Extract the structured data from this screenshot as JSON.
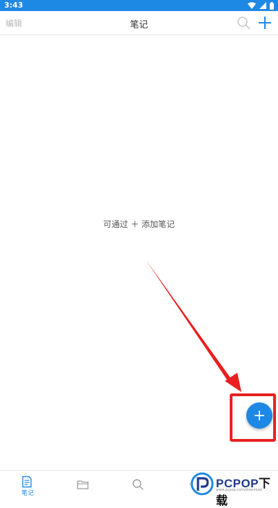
{
  "status_bar": {
    "time": "3:43",
    "icons": [
      "wifi-icon",
      "signal-icon",
      "battery-icon"
    ]
  },
  "header": {
    "edit_label": "编辑",
    "title": "笔记"
  },
  "main": {
    "empty_hint": "可通过 ＋ 添加笔记"
  },
  "tab_bar": {
    "tabs": [
      {
        "label": "笔记",
        "icon": "note-icon",
        "active": true
      },
      {
        "label": "",
        "icon": "folder-icon",
        "active": false
      },
      {
        "label": "",
        "icon": "search-icon",
        "active": false
      },
      {
        "label": "",
        "icon": "settings-icon",
        "active": false
      },
      {
        "label": "",
        "icon": "profile-icon",
        "active": false
      }
    ]
  },
  "watermark": {
    "brand": "PCPOP",
    "brand_suffix": "下载",
    "url": "www.pcpop.com/download"
  },
  "colors": {
    "accent": "#1e88e5",
    "annotation": "#e8201f",
    "muted_text": "#b8b8b8"
  }
}
